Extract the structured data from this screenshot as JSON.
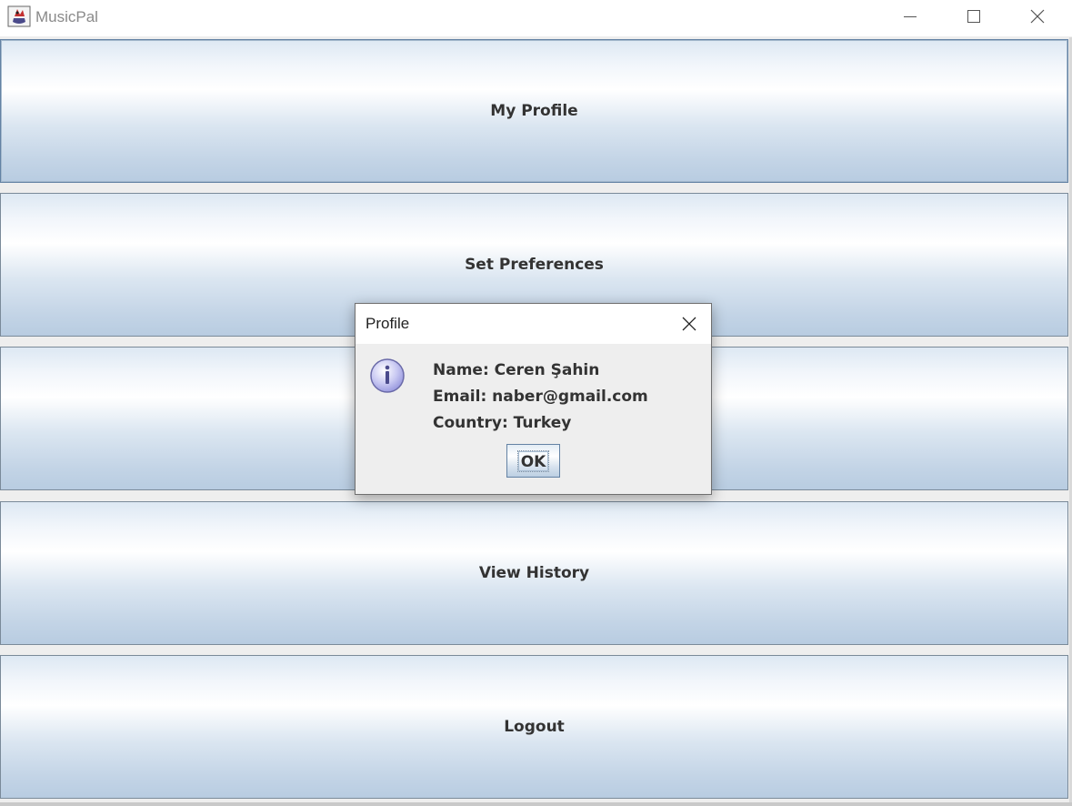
{
  "window": {
    "title": "MusicPal",
    "icon": "java-cup-icon"
  },
  "main_buttons": [
    {
      "label": "My Profile"
    },
    {
      "label": "Set Preferences"
    },
    {
      "label": ""
    },
    {
      "label": "View History"
    },
    {
      "label": "Logout"
    }
  ],
  "dialog": {
    "title": "Profile",
    "icon": "info-icon",
    "lines": [
      "Name: Ceren Şahin",
      "Email: naber@gmail.com",
      "Country: Turkey"
    ],
    "ok_label": "OK"
  },
  "colors": {
    "button_gradient_top": "#dde8f3",
    "button_gradient_mid": "#ffffff",
    "button_gradient_bottom": "#b8cce1",
    "button_text": "#333333",
    "dialog_background": "#eeeeee"
  }
}
